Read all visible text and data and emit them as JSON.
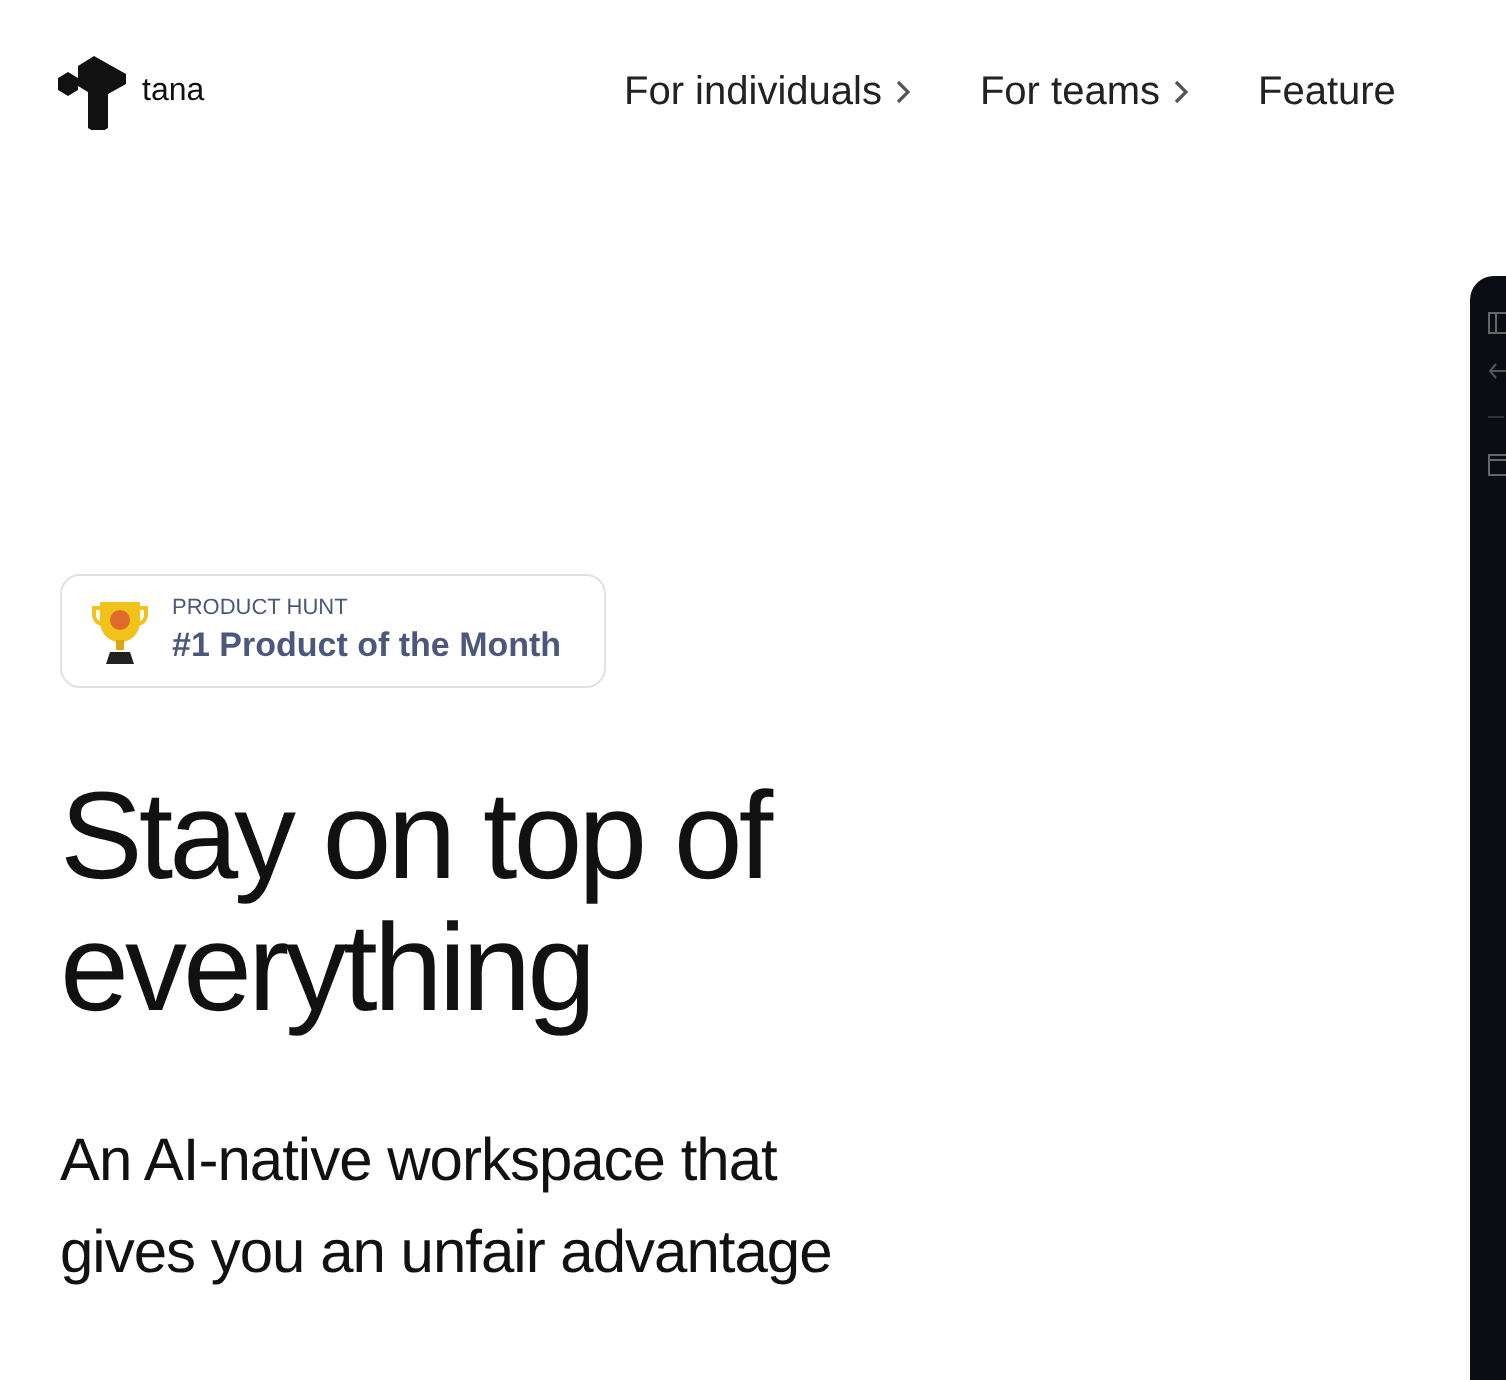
{
  "header": {
    "logo": "tana",
    "nav": [
      {
        "label": "For individuals",
        "has_caret": true
      },
      {
        "label": "For teams",
        "has_caret": true
      },
      {
        "label": "Feature",
        "has_caret": false
      }
    ]
  },
  "hero": {
    "badge": {
      "eyebrow": "PRODUCT HUNT",
      "title": "#1 Product of the Month"
    },
    "heading": "Stay on top of everything",
    "subheading": "An AI-native workspace that gives you an unfair advantage"
  }
}
